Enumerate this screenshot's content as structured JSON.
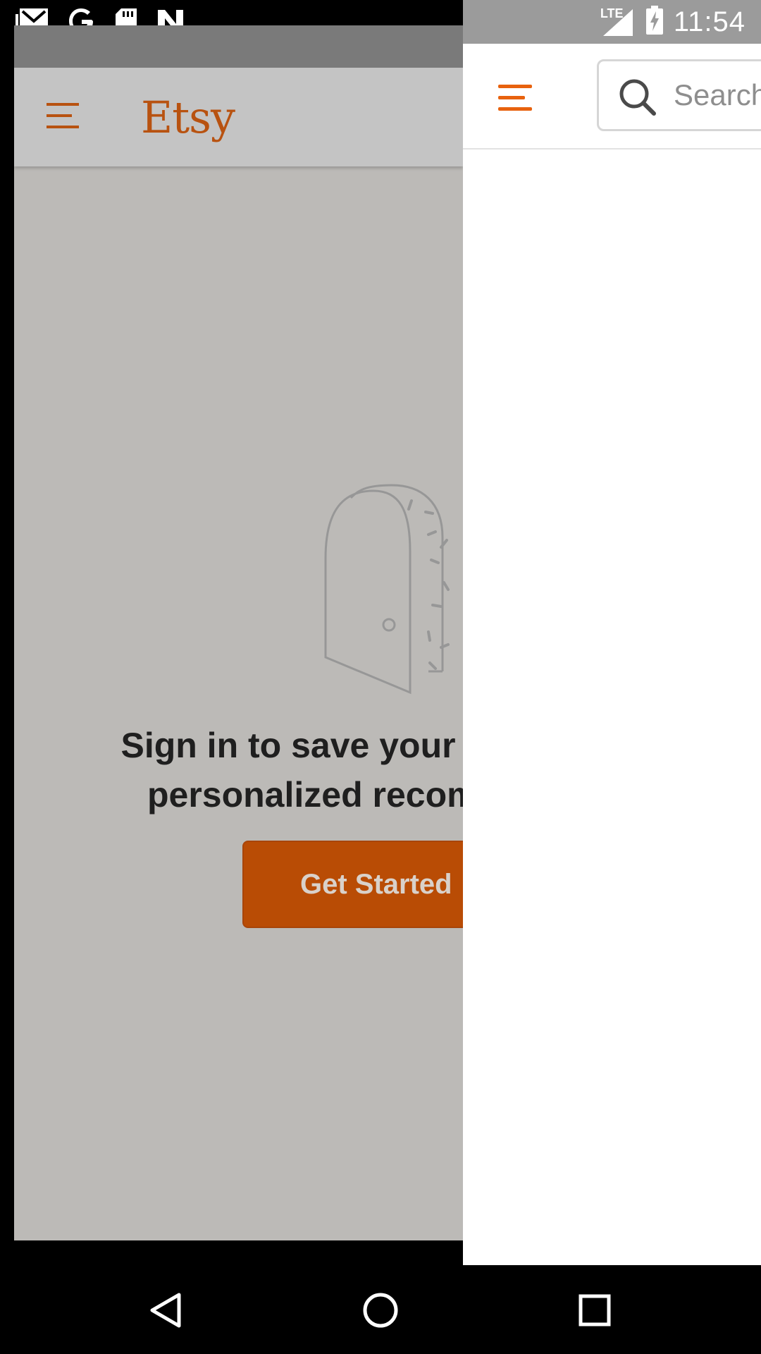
{
  "status_bar": {
    "time": "11:54",
    "network_label": "LTE",
    "left_icons": [
      "gmail-icon",
      "google-icon",
      "sd-card-icon",
      "n-icon"
    ],
    "right_icons": [
      "signal-icon",
      "battery-charging-icon"
    ]
  },
  "background_app": {
    "logo": "Etsy",
    "signin_message": "Sign in to save your fave\npersonalized recomm",
    "cta_label": "Get Started",
    "colors": {
      "brand": "#b94c05"
    }
  },
  "drawer": {
    "search_placeholder": "Search",
    "colors": {
      "menu": "#e8620e"
    }
  },
  "nav_bar": {
    "buttons": [
      "back-icon",
      "home-icon",
      "recents-icon"
    ]
  }
}
